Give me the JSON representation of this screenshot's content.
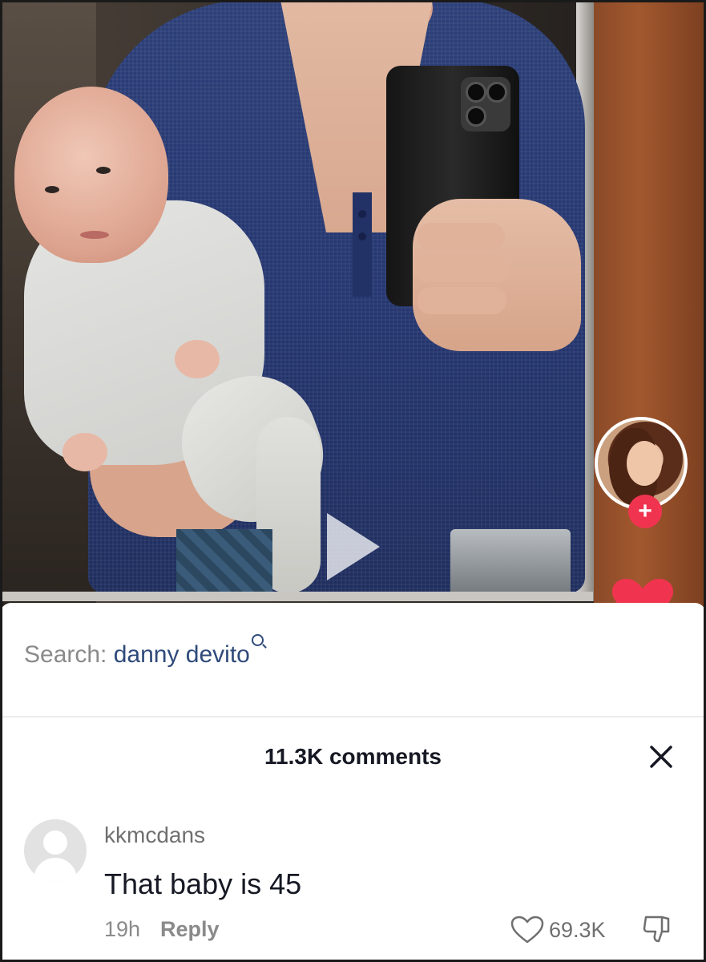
{
  "video": {
    "description_icons": [
      "play-icon",
      "creator-avatar",
      "follow-plus-icon",
      "like-heart-icon"
    ],
    "follow_label": "+"
  },
  "search": {
    "prefix": "Search: ",
    "term": "danny devito"
  },
  "comments": {
    "count_label": "11.3K comments",
    "items": [
      {
        "username": "kkmcdans",
        "text": "That baby is 45",
        "time": "19h",
        "reply_label": "Reply",
        "likes": "69.3K"
      }
    ]
  },
  "colors": {
    "accent_red": "#f0344f",
    "search_term": "#2f4a7a",
    "text_primary": "#161823",
    "text_secondary": "#8a8a8a"
  }
}
